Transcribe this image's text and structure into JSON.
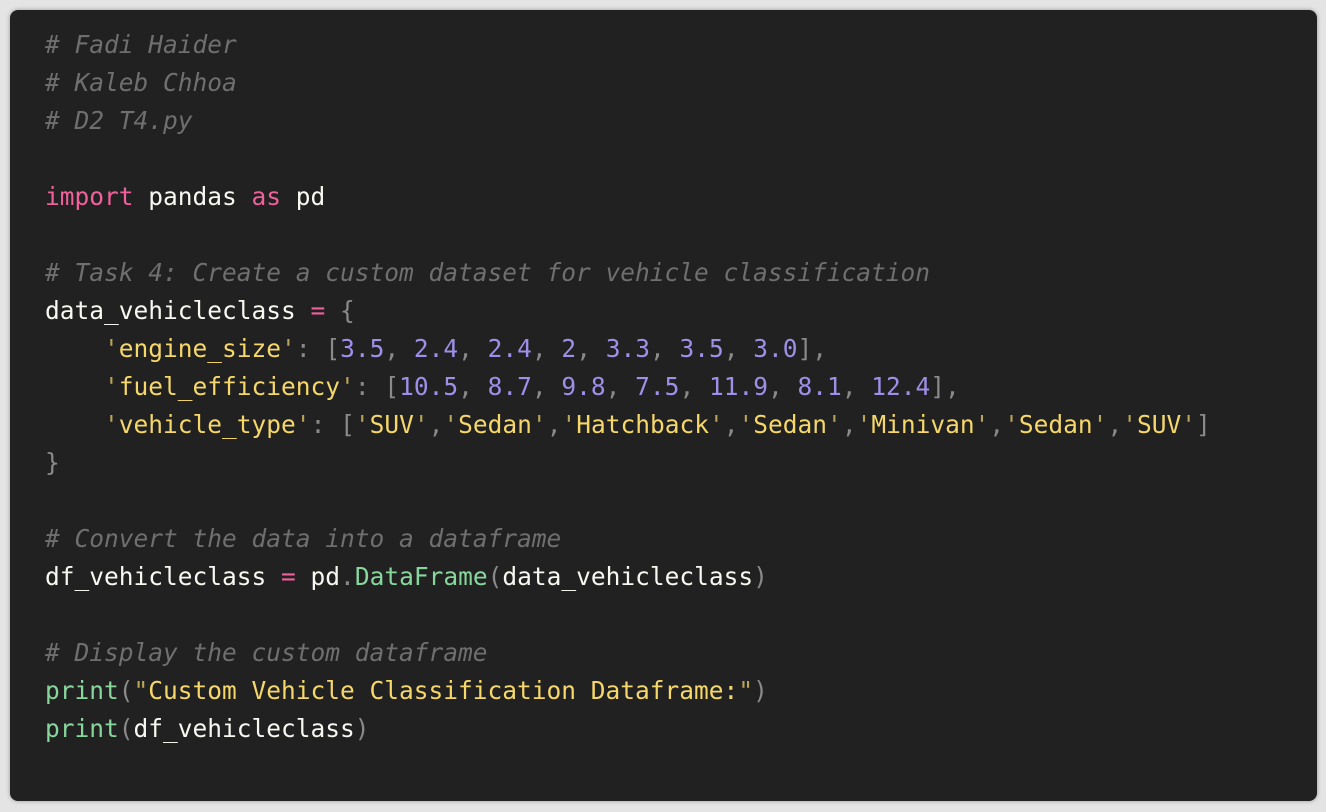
{
  "theme": {
    "background": "#212121",
    "page_background": "#e4e4e4",
    "comment": "#6f6f6f",
    "keyword": "#f0609b",
    "identifier": "#f8f8f2",
    "punctuation": "#8a8a8a",
    "string": "#f5d76a",
    "number": "#9f8fe8",
    "function": "#87d79d"
  },
  "code_lines": [
    [
      {
        "t": "comment",
        "v": "# Fadi Haider"
      }
    ],
    [
      {
        "t": "comment",
        "v": "# Kaleb Chhoa"
      }
    ],
    [
      {
        "t": "comment",
        "v": "# D2 T4.py"
      }
    ],
    [],
    [
      {
        "t": "keyword",
        "v": "import"
      },
      {
        "t": "ident",
        "v": " pandas "
      },
      {
        "t": "keyword",
        "v": "as"
      },
      {
        "t": "ident",
        "v": " pd"
      }
    ],
    [],
    [
      {
        "t": "comment",
        "v": "# Task 4: Create a custom dataset for vehicle classification"
      }
    ],
    [
      {
        "t": "ident",
        "v": "data_vehicleclass "
      },
      {
        "t": "operator",
        "v": "="
      },
      {
        "t": "ident",
        "v": " "
      },
      {
        "t": "punct",
        "v": "{"
      }
    ],
    [
      {
        "t": "ident",
        "v": "    "
      },
      {
        "t": "quote",
        "v": "'"
      },
      {
        "t": "string",
        "v": "engine_size"
      },
      {
        "t": "quote",
        "v": "'"
      },
      {
        "t": "punct",
        "v": ": ["
      },
      {
        "t": "number",
        "v": "3.5"
      },
      {
        "t": "punct",
        "v": ", "
      },
      {
        "t": "number",
        "v": "2.4"
      },
      {
        "t": "punct",
        "v": ", "
      },
      {
        "t": "number",
        "v": "2.4"
      },
      {
        "t": "punct",
        "v": ", "
      },
      {
        "t": "number",
        "v": "2"
      },
      {
        "t": "punct",
        "v": ", "
      },
      {
        "t": "number",
        "v": "3.3"
      },
      {
        "t": "punct",
        "v": ", "
      },
      {
        "t": "number",
        "v": "3.5"
      },
      {
        "t": "punct",
        "v": ", "
      },
      {
        "t": "number",
        "v": "3.0"
      },
      {
        "t": "punct",
        "v": "],"
      }
    ],
    [
      {
        "t": "ident",
        "v": "    "
      },
      {
        "t": "quote",
        "v": "'"
      },
      {
        "t": "string",
        "v": "fuel_efficiency"
      },
      {
        "t": "quote",
        "v": "'"
      },
      {
        "t": "punct",
        "v": ": ["
      },
      {
        "t": "number",
        "v": "10.5"
      },
      {
        "t": "punct",
        "v": ", "
      },
      {
        "t": "number",
        "v": "8.7"
      },
      {
        "t": "punct",
        "v": ", "
      },
      {
        "t": "number",
        "v": "9.8"
      },
      {
        "t": "punct",
        "v": ", "
      },
      {
        "t": "number",
        "v": "7.5"
      },
      {
        "t": "punct",
        "v": ", "
      },
      {
        "t": "number",
        "v": "11.9"
      },
      {
        "t": "punct",
        "v": ", "
      },
      {
        "t": "number",
        "v": "8.1"
      },
      {
        "t": "punct",
        "v": ", "
      },
      {
        "t": "number",
        "v": "12.4"
      },
      {
        "t": "punct",
        "v": "],"
      }
    ],
    [
      {
        "t": "ident",
        "v": "    "
      },
      {
        "t": "quote",
        "v": "'"
      },
      {
        "t": "string",
        "v": "vehicle_type"
      },
      {
        "t": "quote",
        "v": "'"
      },
      {
        "t": "punct",
        "v": ": ["
      },
      {
        "t": "quote",
        "v": "'"
      },
      {
        "t": "string",
        "v": "SUV"
      },
      {
        "t": "quote",
        "v": "'"
      },
      {
        "t": "punct",
        "v": ","
      },
      {
        "t": "quote",
        "v": "'"
      },
      {
        "t": "string",
        "v": "Sedan"
      },
      {
        "t": "quote",
        "v": "'"
      },
      {
        "t": "punct",
        "v": ","
      },
      {
        "t": "quote",
        "v": "'"
      },
      {
        "t": "string",
        "v": "Hatchback"
      },
      {
        "t": "quote",
        "v": "'"
      },
      {
        "t": "punct",
        "v": ","
      },
      {
        "t": "quote",
        "v": "'"
      },
      {
        "t": "string",
        "v": "Sedan"
      },
      {
        "t": "quote",
        "v": "'"
      },
      {
        "t": "punct",
        "v": ","
      },
      {
        "t": "quote",
        "v": "'"
      },
      {
        "t": "string",
        "v": "Minivan"
      },
      {
        "t": "quote",
        "v": "'"
      },
      {
        "t": "punct",
        "v": ","
      },
      {
        "t": "quote",
        "v": "'"
      },
      {
        "t": "string",
        "v": "Sedan"
      },
      {
        "t": "quote",
        "v": "'"
      },
      {
        "t": "punct",
        "v": ","
      },
      {
        "t": "quote",
        "v": "'"
      },
      {
        "t": "string",
        "v": "SUV"
      },
      {
        "t": "quote",
        "v": "'"
      },
      {
        "t": "punct",
        "v": "]"
      }
    ],
    [
      {
        "t": "punct",
        "v": "}"
      }
    ],
    [],
    [
      {
        "t": "comment",
        "v": "# Convert the data into a dataframe"
      }
    ],
    [
      {
        "t": "ident",
        "v": "df_vehicleclass "
      },
      {
        "t": "operator",
        "v": "="
      },
      {
        "t": "ident",
        "v": " pd"
      },
      {
        "t": "punct",
        "v": "."
      },
      {
        "t": "func",
        "v": "DataFrame"
      },
      {
        "t": "punct",
        "v": "("
      },
      {
        "t": "ident",
        "v": "data_vehicleclass"
      },
      {
        "t": "punct",
        "v": ")"
      }
    ],
    [],
    [
      {
        "t": "comment",
        "v": "# Display the custom dataframe"
      }
    ],
    [
      {
        "t": "func",
        "v": "print"
      },
      {
        "t": "punct",
        "v": "("
      },
      {
        "t": "quote",
        "v": "\""
      },
      {
        "t": "string",
        "v": "Custom Vehicle Classification Dataframe:"
      },
      {
        "t": "quote",
        "v": "\""
      },
      {
        "t": "punct",
        "v": ")"
      }
    ],
    [
      {
        "t": "func",
        "v": "print"
      },
      {
        "t": "punct",
        "v": "("
      },
      {
        "t": "ident",
        "v": "df_vehicleclass"
      },
      {
        "t": "punct",
        "v": ")"
      }
    ]
  ]
}
